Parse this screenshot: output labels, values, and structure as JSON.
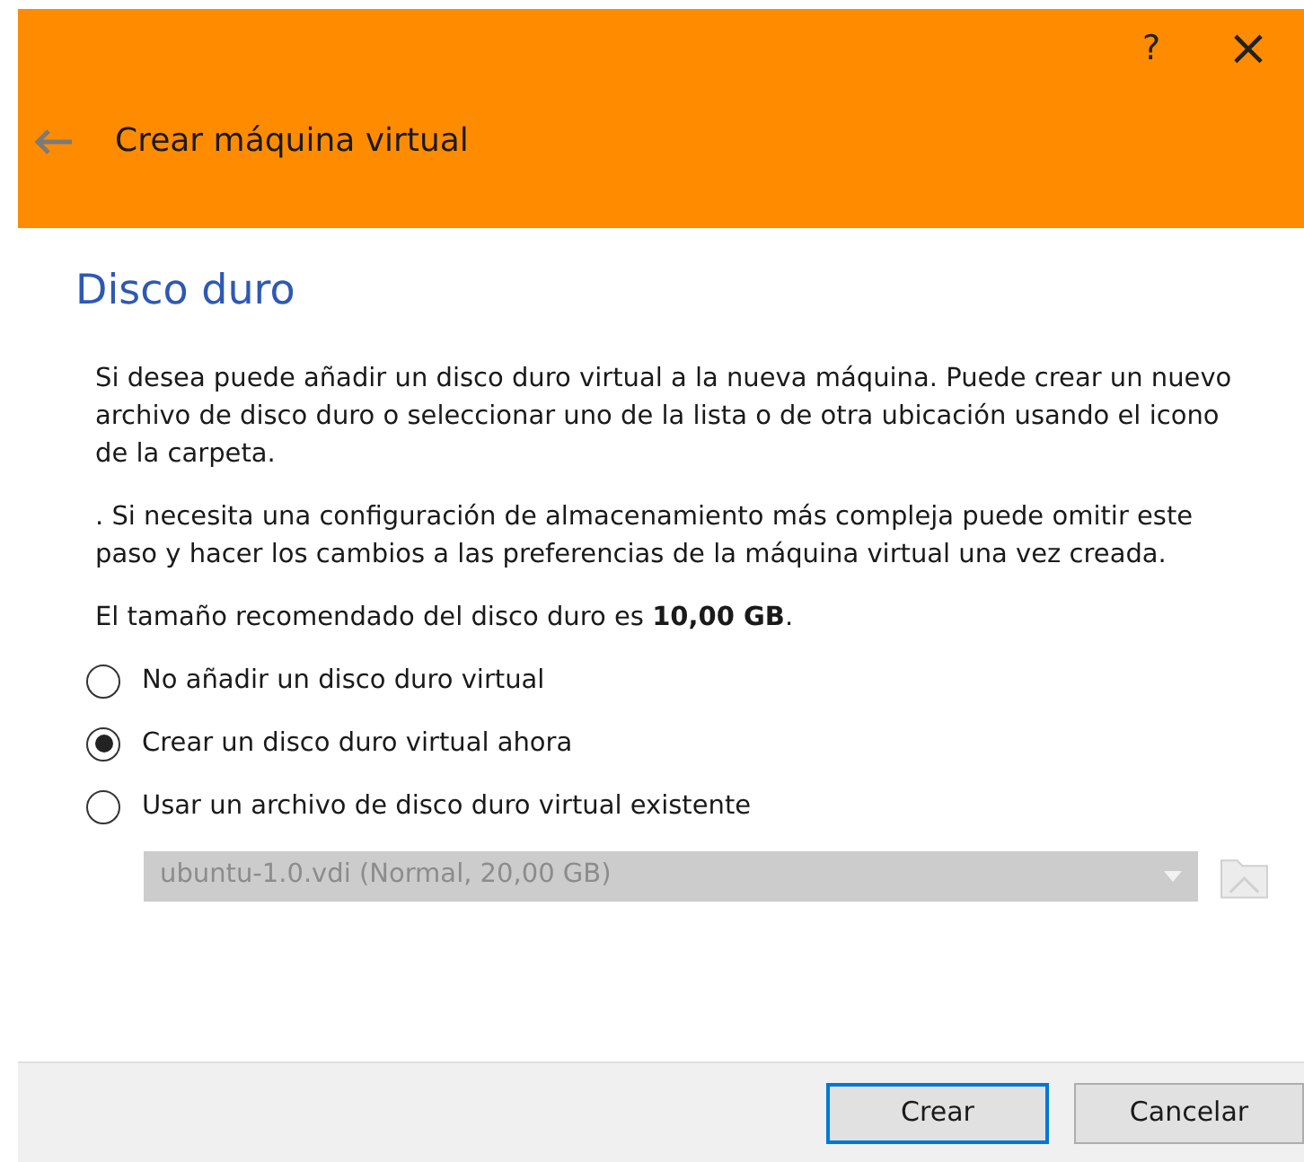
{
  "window": {
    "help": "?",
    "close": "×",
    "title": "Crear máquina virtual"
  },
  "heading": "Disco duro",
  "paragraphs": [
    "Si desea puede añadir un disco duro virtual a la nueva máquina. Puede crear un nuevo archivo de disco duro o seleccionar uno de la lista o de otra ubicación usando el icono de la carpeta.",
    ". Si necesita una configuración de almacenamiento más compleja puede omitir este paso y hacer los cambios a las preferencias de la máquina virtual una vez creada.",
    "El tamaño recomendado del disco duro es **10,00 GB**."
  ],
  "options": [
    {
      "label": "No añadir un disco duro virtual",
      "selected": false
    },
    {
      "label": "Crear un disco duro virtual ahora",
      "selected": true
    },
    {
      "label": "Usar un archivo de disco duro virtual existente",
      "selected": false
    }
  ],
  "disk_select": {
    "value": "ubuntu-1.0.vdi (Normal, 20,00 GB)",
    "disabled": true
  },
  "buttons": [
    {
      "label": "Crear",
      "default": true
    },
    {
      "label": "Cancelar",
      "default": false
    }
  ]
}
